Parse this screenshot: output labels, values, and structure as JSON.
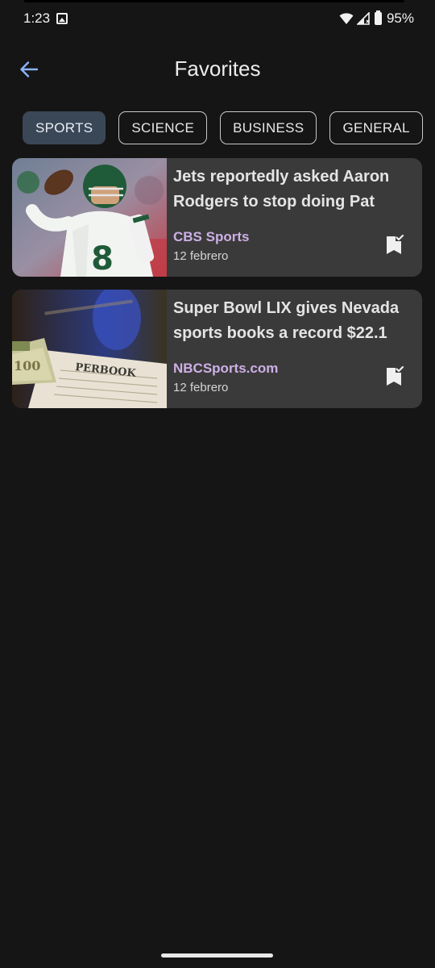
{
  "status_bar": {
    "time": "1:23",
    "battery": "95%",
    "icons": [
      "image-icon",
      "wifi-icon",
      "signal-icon",
      "battery-icon"
    ]
  },
  "app_bar": {
    "title": "Favorites",
    "back_icon": "arrow-back-icon"
  },
  "chips": [
    {
      "label": "SPORTS",
      "selected": true
    },
    {
      "label": "SCIENCE",
      "selected": false
    },
    {
      "label": "BUSINESS",
      "selected": false
    },
    {
      "label": "GENERAL",
      "selected": false
    }
  ],
  "articles": [
    {
      "title": "Jets reportedly asked Aaron Rodgers to stop doing Pat",
      "source": "CBS Sports",
      "date": "12 febrero",
      "thumbnail": "football-quarterback-photo",
      "bookmark_icon": "bookmark-added-icon"
    },
    {
      "title": "Super Bowl LIX gives Nevada sports books a record $22.1",
      "source": "NBCSports.com",
      "date": "12 febrero",
      "thumbnail": "sportsbook-cash-photo",
      "bookmark_icon": "bookmark-added-icon"
    }
  ],
  "colors": {
    "background": "#151515",
    "card": "#3a3a3a",
    "source_text": "#cdb0e6",
    "chip_selected": "#3a4756",
    "accent_back": "#8ab4f8"
  }
}
